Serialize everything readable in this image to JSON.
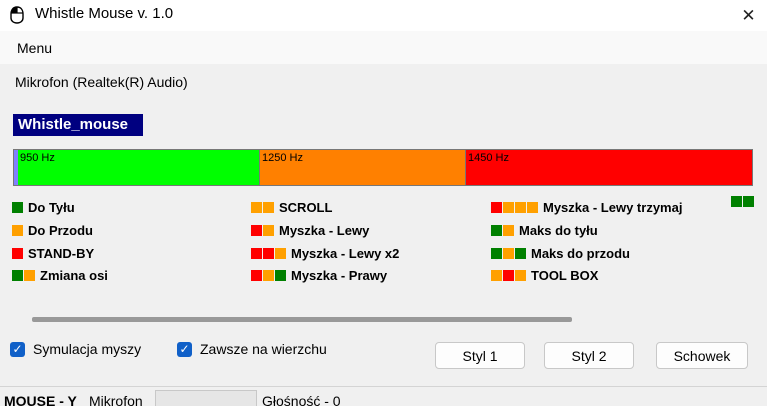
{
  "window": {
    "title": "Whistle Mouse v. 1.0",
    "app_icon": "mouse-icon",
    "close_icon": "close-icon",
    "close_glyph": "✕"
  },
  "menu": {
    "items": [
      "Menu"
    ]
  },
  "device": {
    "label": "Mikrofon (Realtek(R) Audio)"
  },
  "profile": {
    "name": "Whistle_mouse"
  },
  "frequency_bands": [
    {
      "label": "950 Hz",
      "color": "#00ff00"
    },
    {
      "label": "1250 Hz",
      "color": "#ff8000"
    },
    {
      "label": "1450 Hz",
      "color": "#ff0000"
    }
  ],
  "colors": {
    "green": "#008000",
    "orange": "#ffa000",
    "red": "#ff0000",
    "title_bg": "#000080",
    "marker": "#8080ff",
    "checkbox": "#1060c8"
  },
  "legend": [
    {
      "name": "legend-do-tylu",
      "label": "Do Tyłu",
      "codes": [
        "green"
      ]
    },
    {
      "name": "legend-do-przodu",
      "label": "Do Przodu",
      "codes": [
        "orange"
      ]
    },
    {
      "name": "legend-stand-by",
      "label": "STAND-BY",
      "codes": [
        "red"
      ]
    },
    {
      "name": "legend-zmiana-osi",
      "label": "Zmiana osi",
      "codes": [
        "green",
        "orange"
      ]
    },
    {
      "name": "legend-scroll",
      "label": "SCROLL",
      "codes": [
        "orange",
        "orange"
      ]
    },
    {
      "name": "legend-myszka-lewy",
      "label": "Myszka - Lewy",
      "codes": [
        "red",
        "orange"
      ]
    },
    {
      "name": "legend-myszka-lewy-x2",
      "label": "Myszka - Lewy x2",
      "codes": [
        "red",
        "red",
        "orange"
      ]
    },
    {
      "name": "legend-myszka-prawy",
      "label": "Myszka - Prawy",
      "codes": [
        "red",
        "orange",
        "green"
      ]
    },
    {
      "name": "legend-myszka-lewy-trzymaj",
      "label": "Myszka - Lewy trzymaj",
      "codes": [
        "red",
        "orange",
        "orange",
        "orange"
      ]
    },
    {
      "name": "legend-maks-do-tylu",
      "label": "Maks do tyłu",
      "codes": [
        "green",
        "orange"
      ]
    },
    {
      "name": "legend-maks-do-przodu",
      "label": "Maks do przodu",
      "codes": [
        "green",
        "orange",
        "green"
      ]
    },
    {
      "name": "legend-tool-box",
      "label": "TOOL BOX",
      "codes": [
        "orange",
        "red",
        "orange"
      ]
    }
  ],
  "extra_squares": [
    "green",
    "green"
  ],
  "scrollbar": {
    "progress": 1.0
  },
  "options": {
    "simulation": {
      "label": "Symulacja myszy",
      "checked": true
    },
    "always_on_top": {
      "label": "Zawsze na wierzchu",
      "checked": true
    }
  },
  "buttons": {
    "style1": "Styl 1",
    "style2": "Styl 2",
    "clipboard": "Schowek"
  },
  "status": {
    "mode": "MOUSE - Y",
    "mic_label": "Mikrofon",
    "volume": "Głośność - 0"
  }
}
